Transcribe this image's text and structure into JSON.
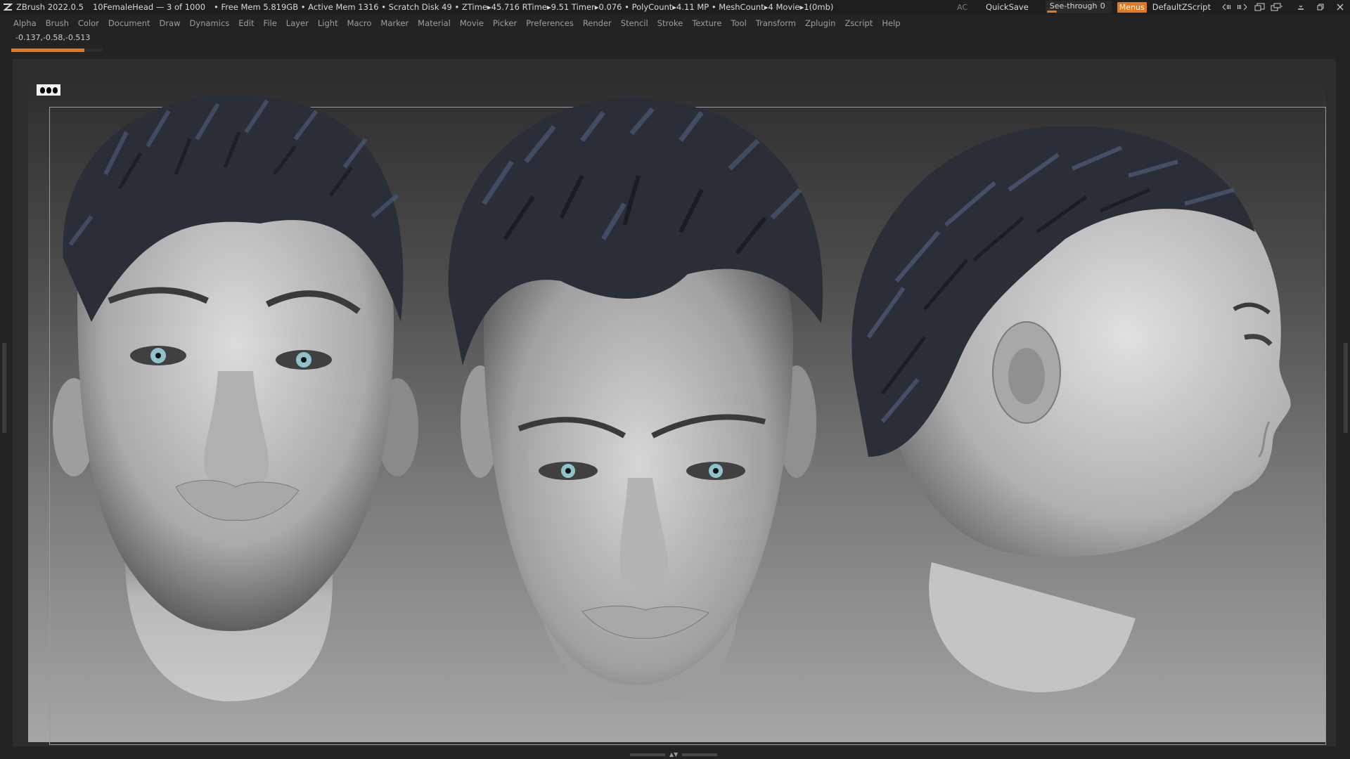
{
  "titlebar": {
    "app": "ZBrush 2022.0.5",
    "document": "10FemaleHead — 3 of 1000",
    "stats": "• Free Mem 5.819GB • Active Mem 1316 • Scratch Disk 49 • ZTime▸45.716 RTime▸9.51 Timer▸0.076 • PolyCount▸4.11 MP • MeshCount▸4 Movie▸1(0mb)",
    "ac_label": "AC",
    "quicksave_label": "QuickSave",
    "seethrough_label": "See-through",
    "seethrough_value": "0",
    "menus_label": "Menus",
    "script_label": "DefaultZScript"
  },
  "menubar": {
    "items": [
      "Alpha",
      "Brush",
      "Color",
      "Document",
      "Draw",
      "Dynamics",
      "Edit",
      "File",
      "Layer",
      "Light",
      "Macro",
      "Marker",
      "Material",
      "Movie",
      "Picker",
      "Preferences",
      "Render",
      "Stencil",
      "Stroke",
      "Texture",
      "Tool",
      "Transform",
      "Zplugin",
      "Zscript",
      "Help"
    ]
  },
  "coords": "-0.137,-0.58,-0.513",
  "progress": {
    "fraction": 0.8
  },
  "colors": {
    "accent": "#e8761d",
    "background": "#232323",
    "hair": "#2a2e36",
    "hair_highlight": "#4a5a78",
    "skin": "#bdbdbd",
    "iris": "#8fc3cc"
  },
  "icons": {
    "logo": "zbrush-logo-icon",
    "window": [
      "arrow-left-right-icon",
      "arrow-right-icon",
      "layout-icon",
      "layout-alt-icon",
      "minimize-icon",
      "restore-icon",
      "close-icon"
    ]
  }
}
